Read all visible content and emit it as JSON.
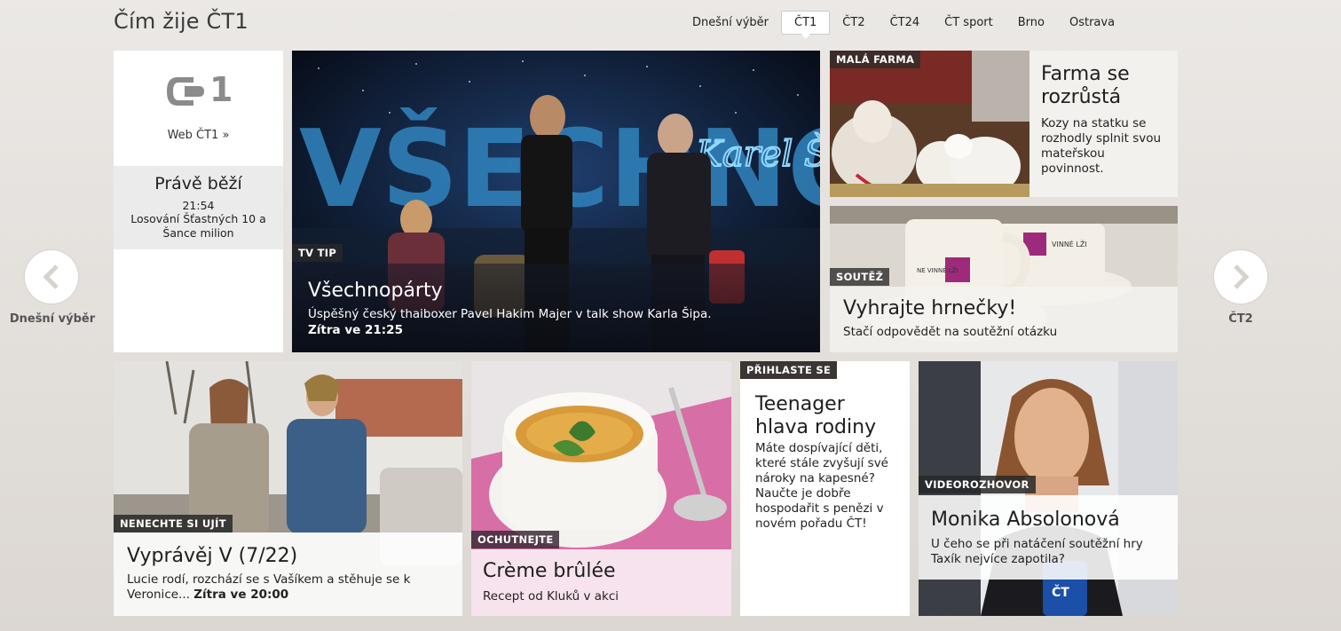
{
  "header": {
    "title": "Čím žije ČT1",
    "nav": [
      "Dnešní výběr",
      "ČT1",
      "ČT2",
      "ČT24",
      "ČT sport",
      "Brno",
      "Ostrava"
    ],
    "active_nav": "ČT1"
  },
  "channel_box": {
    "logo_text": "1",
    "web_link": "Web ČT1 »",
    "now_playing_title": "Právě běží",
    "now_playing_time": "21:54",
    "now_playing_show": "Losování Šťastných 10 a Šance milion"
  },
  "arrows": {
    "prev_label": "Dnešní výběr",
    "next_label": "ČT2"
  },
  "tiles": {
    "main": {
      "badge": "TV TIP",
      "title": "Všechnopárty",
      "desc": "Úspěšný český thaiboxer Pavel Hakim Majer v talk show Karla Šipa.",
      "when": "Zítra ve 21:25",
      "sign_text": "VŠECHNO",
      "neon_text": "Karel Šíp"
    },
    "farm": {
      "badge": "MALÁ FARMA",
      "title": "Farma se rozrůstá",
      "desc": "Kozy na statku se rozhodly splnit svou mateřskou povinnost."
    },
    "contest": {
      "badge": "SOUTĚŽ",
      "title": "Vyhrajte hrnečky!",
      "desc": "Stačí odpovědět na soutěžní otázku",
      "mug_text_1": "NE VINNÉ LŽI",
      "mug_text_2": "VINNÉ LŽI"
    },
    "series": {
      "badge": "NENECHTE SI UJÍT",
      "title": "Vyprávěj V (7/22)",
      "desc": "Lucie rodí, rozchází se s Vašíkem a stěhuje se k Veronice...",
      "when": "Zítra ve 20:00"
    },
    "dessert": {
      "badge": "OCHUTNEJTE",
      "title": "Crème brûlée",
      "desc": "Recept od Kluků v akci"
    },
    "teen": {
      "badge": "PŘIHLASTE SE",
      "title": "Teenager hlava rodiny",
      "desc": "Máte dospívající děti, které stále zvyšují své nároky na kapesné? Naučte je dobře hospodařit s penězi v novém pořadu ČT!"
    },
    "interview": {
      "badge": "VIDEOROZHOVOR",
      "title": "Monika Absolonová",
      "desc": "U čeho se při natáčení soutěžní hry Taxík nejvíce zapotila?",
      "mic_text": "ČT"
    }
  }
}
